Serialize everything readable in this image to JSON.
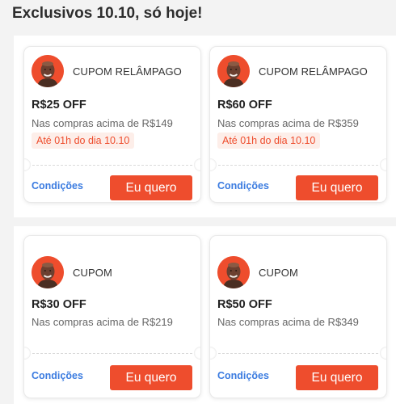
{
  "header": {
    "title": "Exclusivos 10.10, só hoje!"
  },
  "colors": {
    "accent": "#ee4d2d",
    "link": "#3a7be0",
    "expiry_bg": "#fdeee9"
  },
  "avatar_icon": "person-face-avatar",
  "coupons": [
    {
      "type_label": "CUPOM RELÂMPAGO",
      "discount": "R$25 OFF",
      "minimum": "Nas compras acima de R$149",
      "expiry": "Até 01h do dia 10.10",
      "conditions_label": "Condições",
      "button_label": "Eu quero"
    },
    {
      "type_label": "CUPOM RELÂMPAGO",
      "discount": "R$60 OFF",
      "minimum": "Nas compras acima de R$359",
      "expiry": "Até 01h do dia 10.10",
      "conditions_label": "Condições",
      "button_label": "Eu quero"
    },
    {
      "type_label": "CUPOM",
      "discount": "R$30 OFF",
      "minimum": "Nas compras acima de R$219",
      "conditions_label": "Condições",
      "button_label": "Eu quero"
    },
    {
      "type_label": "CUPOM",
      "discount": "R$50 OFF",
      "minimum": "Nas compras acima de R$349",
      "conditions_label": "Condições",
      "button_label": "Eu quero"
    }
  ]
}
